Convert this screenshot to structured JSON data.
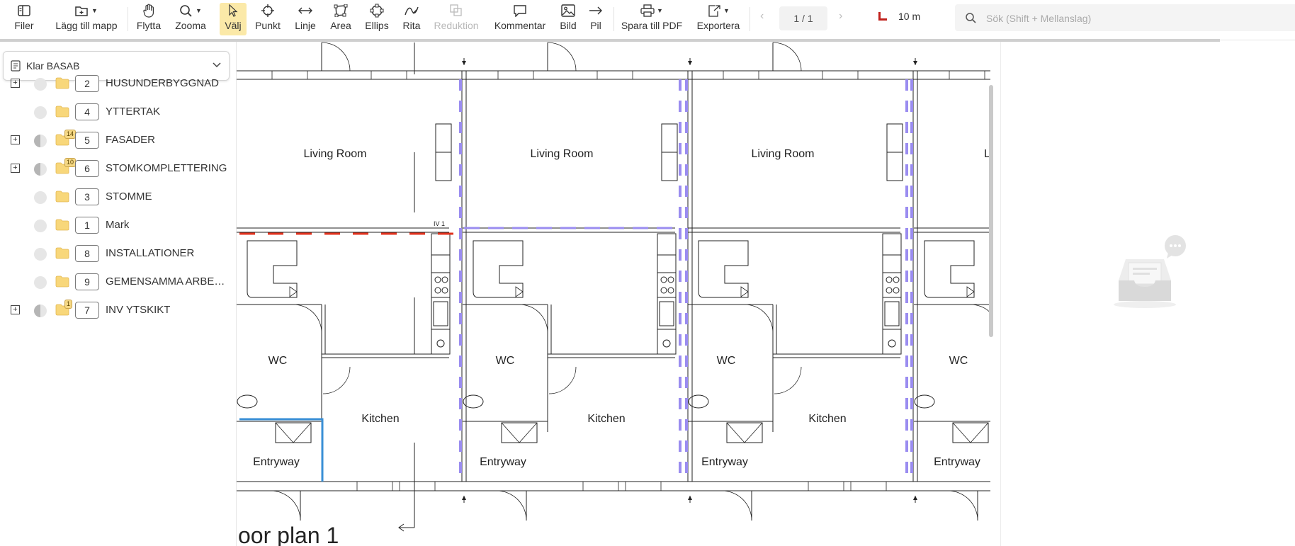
{
  "toolbar": {
    "files": "Filer",
    "add_folder": "Lägg till mapp",
    "move": "Flytta",
    "zoom": "Zooma",
    "select": "Välj",
    "point": "Punkt",
    "line": "Linje",
    "area": "Area",
    "ellipse": "Ellips",
    "draw": "Rita",
    "reduction": "Reduktion",
    "comment": "Kommentar",
    "image": "Bild",
    "arrow": "Pil",
    "save_pdf": "Spara till PDF",
    "export": "Exportera",
    "page": "1 / 1",
    "scale": "10 m",
    "search_placeholder": "Sök (Shift + Mellanslag)"
  },
  "sidebar": {
    "project": "Klar BASAB",
    "items": [
      {
        "num": "2",
        "name": "HUSUNDERBYGGNAD",
        "expandable": true,
        "state": "empty",
        "count": ""
      },
      {
        "num": "4",
        "name": "YTTERTAK",
        "expandable": false,
        "state": "empty",
        "count": ""
      },
      {
        "num": "5",
        "name": "FASADER",
        "expandable": true,
        "state": "half",
        "count": "14"
      },
      {
        "num": "6",
        "name": "STOMKOMPLETTERING",
        "expandable": true,
        "state": "half",
        "count": "10"
      },
      {
        "num": "3",
        "name": "STOMME",
        "expandable": false,
        "state": "empty",
        "count": ""
      },
      {
        "num": "1",
        "name": "Mark",
        "expandable": false,
        "state": "empty",
        "count": ""
      },
      {
        "num": "8",
        "name": "INSTALLATIONER",
        "expandable": false,
        "state": "empty",
        "count": ""
      },
      {
        "num": "9",
        "name": "GEMENSAMMA ARBETEN",
        "expandable": false,
        "state": "empty",
        "count": ""
      },
      {
        "num": "7",
        "name": "INV YTSKIKT",
        "expandable": true,
        "state": "half",
        "count": "1"
      }
    ]
  },
  "plan": {
    "living_room": "Living Room",
    "living_room_cut": "Li",
    "wc": "WC",
    "kitchen": "Kitchen",
    "entryway": "Entryway",
    "title": "oor plan 1",
    "marker": "IV 1"
  },
  "colors": {
    "accent": "#fbe9a8",
    "purple_markup": "#9a8cf0",
    "red_markup": "#e0321e",
    "blue_markup": "#3a8fd6",
    "folder": "#f8d77a"
  }
}
